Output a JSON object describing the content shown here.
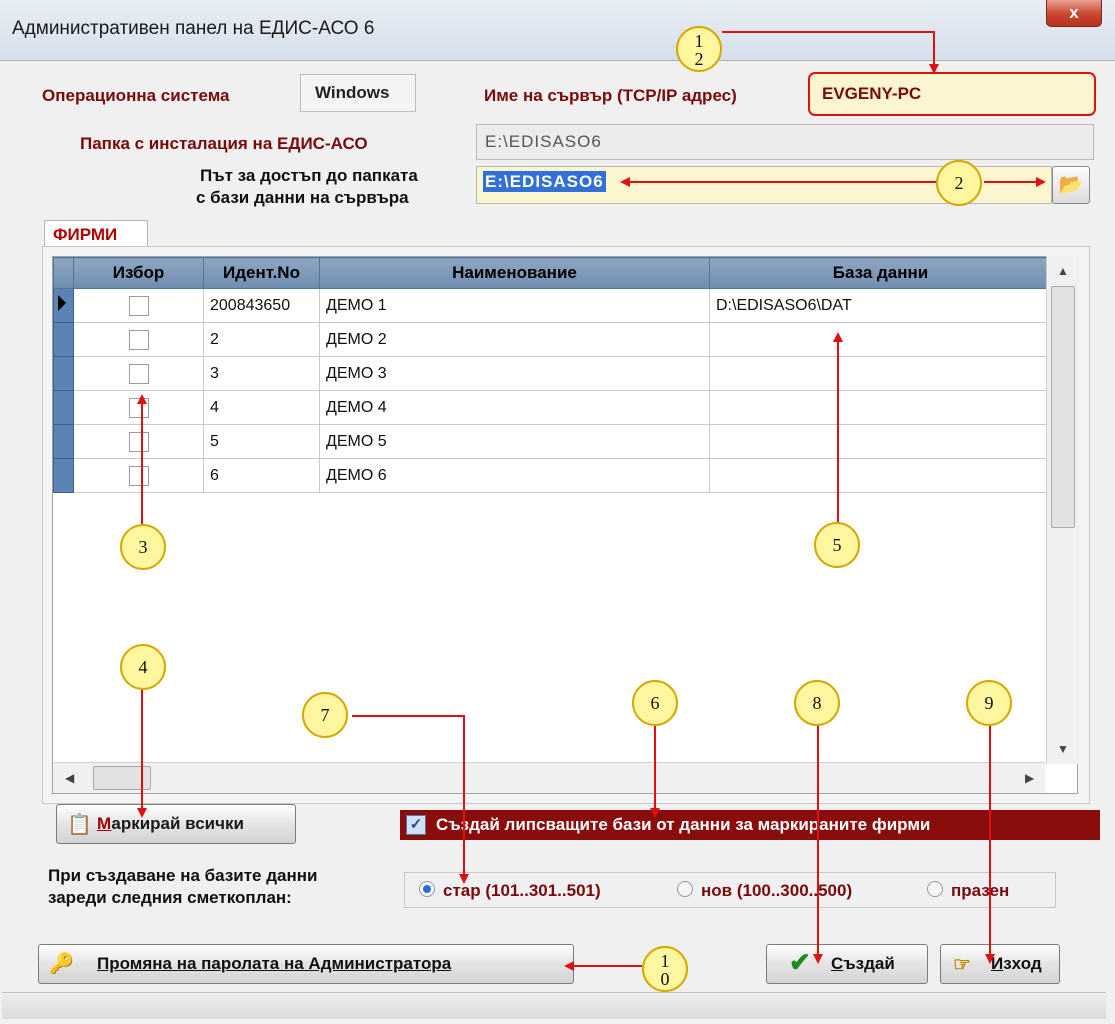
{
  "window": {
    "title": "Административен панел на ЕДИС-АСО 6",
    "close_label": "x"
  },
  "os": {
    "label": "Операционна система",
    "value": "Windows"
  },
  "server": {
    "label": "Име на сървър (TCP/IP адрес)",
    "value": "EVGENY-PC"
  },
  "install": {
    "label": "Папка с инсталация на ЕДИС-АСО",
    "value": "E:\\EDISASO6"
  },
  "db_path": {
    "label_line1": "Път за достъп до папката",
    "label_line2": "с бази данни на сървъра",
    "value": "E:\\EDISASO6"
  },
  "tab": {
    "label": "ФИРМИ"
  },
  "grid": {
    "headers": [
      "Избор",
      "Идент.No",
      "Наименование",
      "База данни"
    ],
    "rows": [
      {
        "id": "200843650",
        "name": "ДЕМО 1",
        "db": "D:\\EDISASO6\\DAT",
        "checked": false,
        "current": true
      },
      {
        "id": "2",
        "name": "ДЕМО 2",
        "db": "",
        "checked": false,
        "current": false
      },
      {
        "id": "3",
        "name": "ДЕМО 3",
        "db": "",
        "checked": false,
        "current": false
      },
      {
        "id": "4",
        "name": "ДЕМО 4",
        "db": "",
        "checked": false,
        "current": false
      },
      {
        "id": "5",
        "name": "ДЕМО 5",
        "db": "",
        "checked": false,
        "current": false
      },
      {
        "id": "6",
        "name": "ДЕМО 6",
        "db": "",
        "checked": false,
        "current": false
      }
    ]
  },
  "mark_all": {
    "first_letter": "М",
    "rest": "аркирай всички"
  },
  "create_missing": {
    "label": "Създай липсващите бази от данни за маркираните фирми",
    "checked": true
  },
  "plan": {
    "label_line1": "При създаване на базите данни",
    "label_line2": "зареди следния сметкоплан:",
    "options": [
      {
        "label": "стар (101..301..501)",
        "selected": true
      },
      {
        "label": "нов (100..300..500)",
        "selected": false
      },
      {
        "label": "празен",
        "selected": false
      }
    ]
  },
  "admin_password_button": "Промяна на паролата на Администратора",
  "create_button": {
    "first_letter": "С",
    "rest": "ъздай"
  },
  "exit_button": {
    "first_letter": "И",
    "rest": "зход"
  },
  "callouts": [
    "1",
    "2",
    "2",
    "3",
    "4",
    "5",
    "6",
    "7",
    "8",
    "9",
    "1",
    "0"
  ],
  "colors": {
    "accent_red": "#7a0a0a",
    "callout_fill": "#fff6a0",
    "annotation_red": "#e01010",
    "grid_header": "#7e98b9"
  }
}
